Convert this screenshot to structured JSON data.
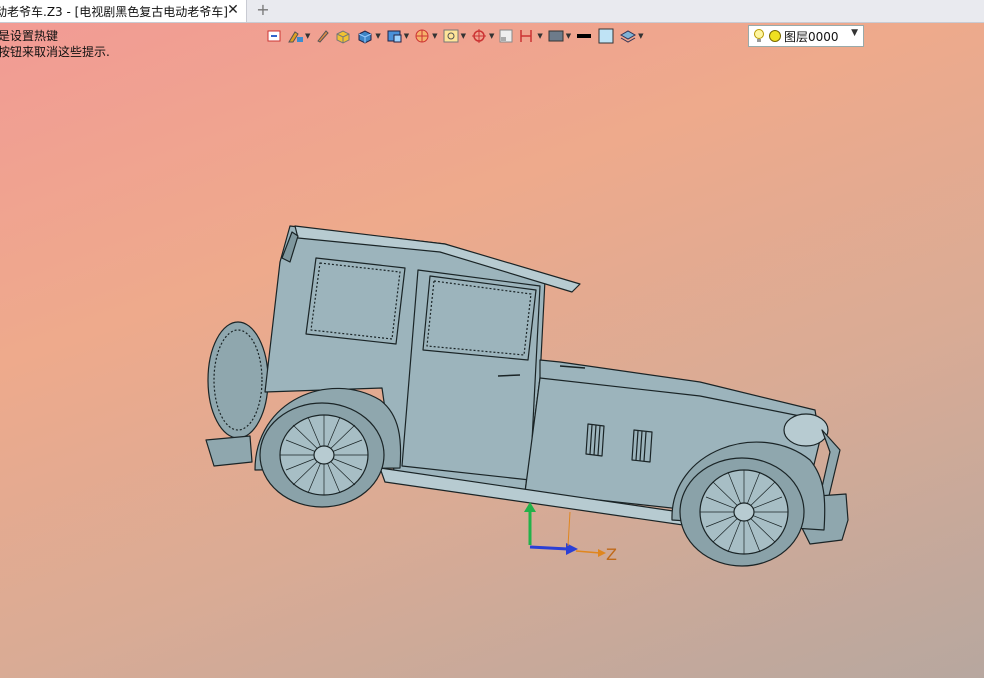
{
  "window": {
    "tab_title": "动老爷车.Z3 - [电视剧黑色复古电动老爷车]",
    "close_symbol": "✕",
    "add_symbol": "+"
  },
  "hints": {
    "line1": "是设置热键",
    "line2": "按钮来取消这些提示."
  },
  "toolbar": {
    "buttons": [
      {
        "name": "selection-filter-icon"
      },
      {
        "name": "color-brush-icon"
      },
      {
        "name": "edit-pen-icon"
      },
      {
        "name": "shaded-box-icon"
      },
      {
        "name": "solid-box-icon"
      },
      {
        "name": "view-box-icon"
      },
      {
        "name": "render-mode-icon"
      },
      {
        "name": "zoom-extents-icon"
      },
      {
        "name": "target-pick-icon"
      },
      {
        "name": "plane-icon"
      },
      {
        "name": "section-icon"
      },
      {
        "name": "display-icon"
      },
      {
        "name": "line-black-icon"
      },
      {
        "name": "color-square-icon"
      },
      {
        "name": "layer-stack-icon"
      }
    ],
    "layer": {
      "label": "图层0000"
    }
  },
  "axis": {
    "z_label": "Z",
    "colors": {
      "x": "#2a3fd6",
      "y": "#22b24a",
      "z": "#e0861e"
    }
  },
  "model": {
    "body_color": "#9cb4bc",
    "edge_color": "#1a2426"
  }
}
